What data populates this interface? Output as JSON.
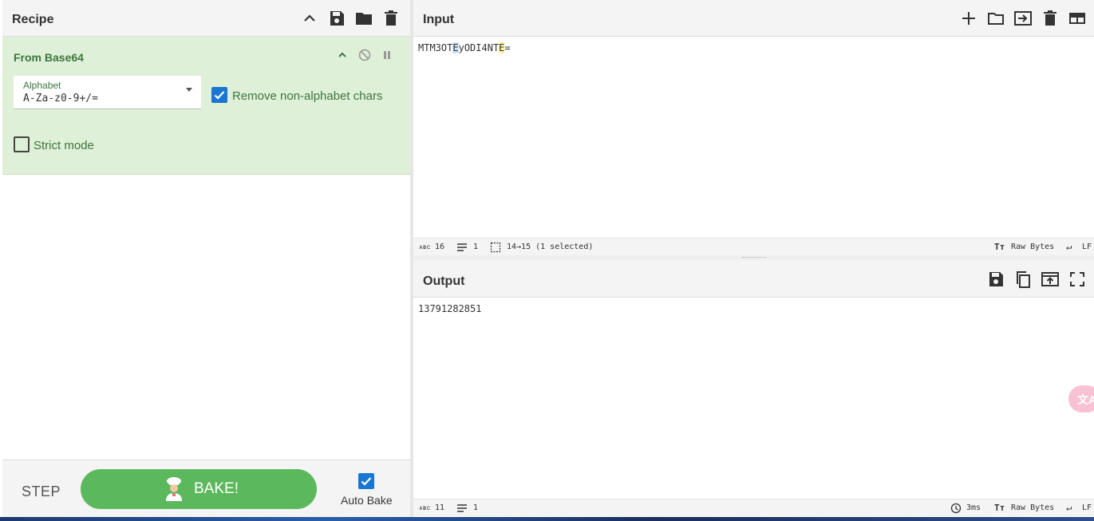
{
  "recipe": {
    "title": "Recipe",
    "operation": {
      "name": "From Base64",
      "alphabet_label": "Alphabet",
      "alphabet_value": "A-Za-z0-9+/=",
      "remove_non_alpha_label": "Remove non-alphabet chars",
      "remove_non_alpha_checked": true,
      "strict_mode_label": "Strict mode",
      "strict_mode_checked": false
    },
    "footer": {
      "step_label": "STEP",
      "bake_label": "BAKE!",
      "auto_bake_label": "Auto Bake",
      "auto_bake_checked": true
    }
  },
  "input": {
    "title": "Input",
    "text_parts": [
      "MTM3OT",
      "E",
      "yODI4NT",
      "E",
      "="
    ],
    "status": {
      "length": "16",
      "lines": "1",
      "selection": "14→15 (1 selected)",
      "encoding": "Raw Bytes",
      "eol": "LF"
    }
  },
  "output": {
    "title": "Output",
    "text": "13791282851",
    "status": {
      "length": "11",
      "lines": "1",
      "time": "3ms",
      "encoding": "Raw Bytes",
      "eol": "LF"
    }
  },
  "colors": {
    "operation_bg": "#dff0d8",
    "operation_text": "#3c763d",
    "bake_button": "#5cb85c",
    "checkbox": "#1976d2",
    "highlight_selection": "#cde4f7",
    "highlight_match": "#fff59d"
  },
  "icons": [
    "chevron-up-icon",
    "save-icon",
    "folder-icon",
    "trash-icon",
    "disable-icon",
    "pause-icon",
    "plus-icon",
    "input-arrow-icon",
    "layout-icon",
    "copy-icon",
    "replace-input-icon",
    "maximize-icon",
    "chef-icon",
    "translate-icon"
  ]
}
